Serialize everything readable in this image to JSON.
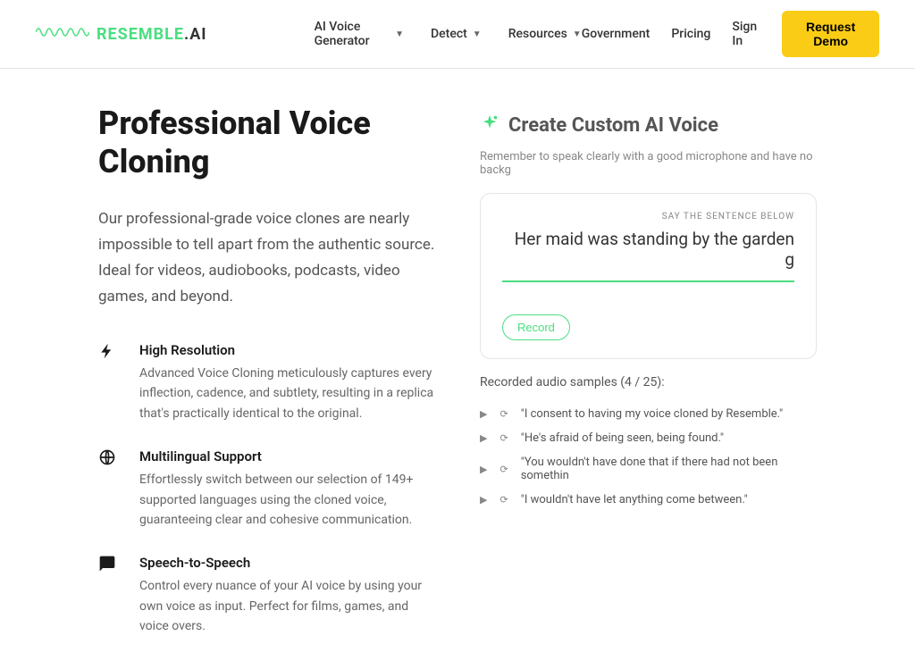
{
  "header": {
    "logo_text_1": "RESEMBLE",
    "logo_text_2": ".AI",
    "nav_center": [
      "AI Voice Generator",
      "Detect",
      "Resources"
    ],
    "nav_right": [
      "Government",
      "Pricing",
      "Sign In"
    ],
    "demo_btn": "Request Demo"
  },
  "main": {
    "title": "Professional Voice Cloning",
    "subtitle": "Our professional-grade voice clones are nearly impossible to tell apart from the authentic source. Ideal for videos, audiobooks, podcasts, video games, and beyond.",
    "features": [
      {
        "title": "High Resolution",
        "desc": "Advanced Voice Cloning meticulously captures every inflection, cadence, and subtlety, resulting in a replica that's practically identical to the original."
      },
      {
        "title": "Multilingual Support",
        "desc": "Effortlessly switch between our selection of 149+ supported languages using the cloned voice, guaranteeing clear and cohesive communication."
      },
      {
        "title": "Speech-to-Speech",
        "desc": "Control every nuance of your AI voice by using your own voice as input. Perfect for films, games, and voice overs."
      }
    ]
  },
  "voice": {
    "title": "Create Custom AI Voice",
    "hint": "Remember to speak clearly with a good microphone and have no backg",
    "card_label": "SAY THE SENTENCE BELOW",
    "sentence": "Her maid was standing by the garden g",
    "record_btn": "Record",
    "samples_title": "Recorded audio samples (4 / 25):",
    "samples": [
      "\"I consent to having my voice cloned by Resemble.\"",
      "\"He's afraid of being seen, being found.\"",
      "\"You wouldn't have done that if there had not been somethin",
      "\"I wouldn't have let anything come between.\""
    ]
  }
}
